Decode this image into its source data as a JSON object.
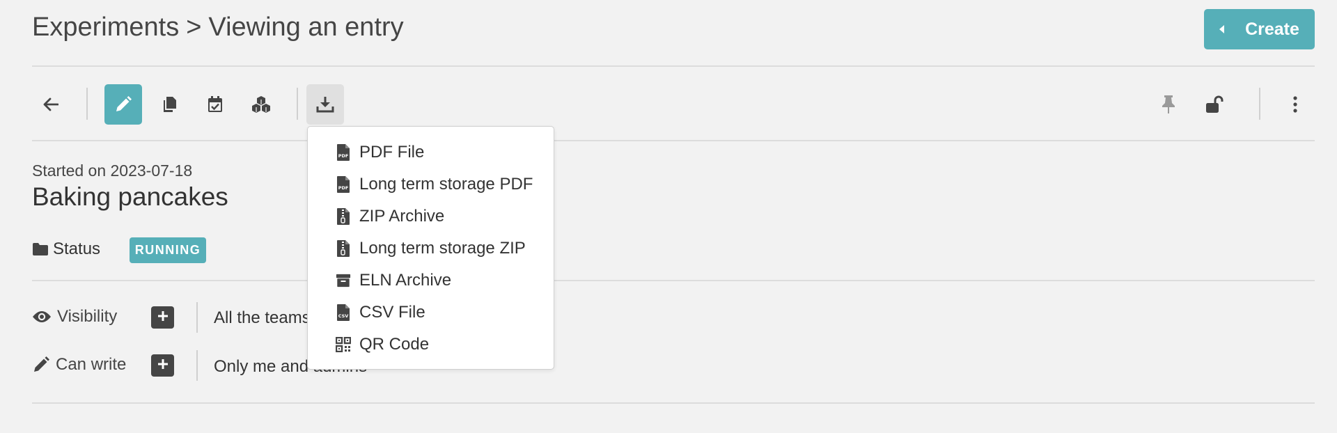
{
  "header": {
    "breadcrumb_root": "Experiments",
    "breadcrumb_separator": ">",
    "breadcrumb_current": "Viewing an entry",
    "create_label": "Create"
  },
  "toolbar": {
    "buttons": [
      "back-arrow-icon",
      "pencil-icon",
      "duplicate-icon",
      "calendar-check-icon",
      "cubes-icon",
      "download-icon",
      "thumbtack-icon",
      "unlock-icon",
      "ellipsis-vertical-icon"
    ]
  },
  "entry": {
    "started_text": "Started on 2023-07-18",
    "title": "Baking pancakes",
    "status_label": "Status",
    "status_value": "RUNNING"
  },
  "permissions": {
    "visibility_label": "Visibility",
    "visibility_value": "All the teams",
    "canwrite_label": "Can write",
    "canwrite_value": "Only me and admins"
  },
  "export_menu": {
    "items": [
      {
        "label": "PDF File",
        "icon": "file-pdf-icon"
      },
      {
        "label": "Long term storage PDF",
        "icon": "file-pdf-icon"
      },
      {
        "label": "ZIP Archive",
        "icon": "file-zip-icon"
      },
      {
        "label": "Long term storage ZIP",
        "icon": "file-zip-icon"
      },
      {
        "label": "ELN Archive",
        "icon": "archive-box-icon"
      },
      {
        "label": "CSV File",
        "icon": "file-csv-icon"
      },
      {
        "label": "QR Code",
        "icon": "qrcode-icon"
      }
    ]
  },
  "colors": {
    "accent": "#56afb8",
    "text": "#333333",
    "background": "#f2f2f2"
  }
}
